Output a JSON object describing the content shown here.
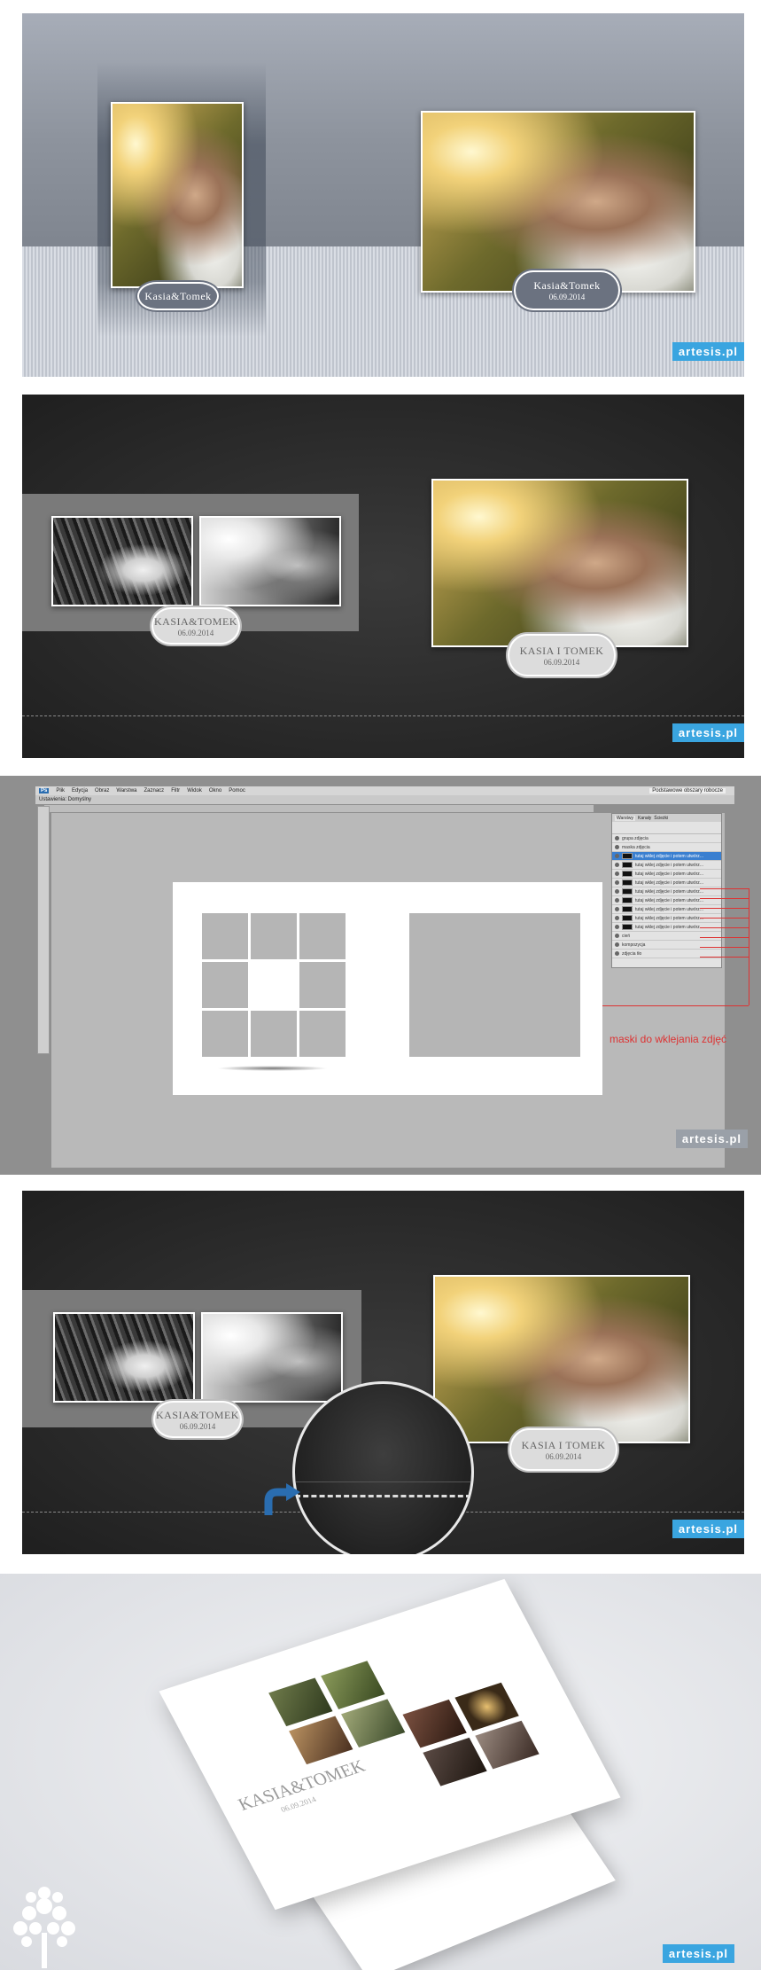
{
  "brand": {
    "watermark": "artesis.pl",
    "accent": "#3aa5e0"
  },
  "panel1": {
    "left_photo": {
      "name": "Kasia&Tomek"
    },
    "right_photo": {
      "name": "Kasia&Tomek",
      "date": "06.09.2014"
    }
  },
  "panel2": {
    "left_plaque": {
      "name": "KASIA&TOMEK",
      "date": "06.09.2014"
    },
    "right_plaque": {
      "name": "KASIA  I  TOMEK",
      "date": "06.09.2014"
    }
  },
  "panel3": {
    "app_menu": [
      "Plik",
      "Edycja",
      "Obraz",
      "Warstwa",
      "Zaznacz",
      "Filtr",
      "Widok",
      "Okno",
      "Pomoc"
    ],
    "document_tab": "Ustawienia: Domyślny",
    "layers_tabs": [
      "Warstwy",
      "Kanały",
      "Ścieżki"
    ],
    "layers": [
      "grupa zdjęcia",
      "maska zdjęcia",
      "tutaj wklej zdjęcie i potem utwórz...",
      "tutaj wklej zdjęcie i potem utwórz...",
      "tutaj wklej zdjęcie i potem utwórz...",
      "tutaj wklej zdjęcie i potem utwórz...",
      "tutaj wklej zdjęcie i potem utwórz...",
      "tutaj wklej zdjęcie i potem utwórz...",
      "tutaj wklej zdjęcie i potem utwórz...",
      "tutaj wklej zdjęcie i potem utwórz...",
      "tutaj wklej zdjęcie i potem utwórz...",
      "cień",
      "kompozycja",
      "zdjęcia tło",
      "tło"
    ],
    "annotation": "maski do wklejania zdjęć",
    "workspace_label": "Podstawowe obszary robocze"
  },
  "panel4": {
    "left_plaque": {
      "name": "KASIA&TOMEK",
      "date": "06.09.2014"
    },
    "right_plaque": {
      "name": "KASIA  I  TOMEK",
      "date": "06.09.2014"
    }
  },
  "panel5": {
    "cover_title": "KASIA&TOMEK",
    "cover_date": "06.09.2014"
  }
}
